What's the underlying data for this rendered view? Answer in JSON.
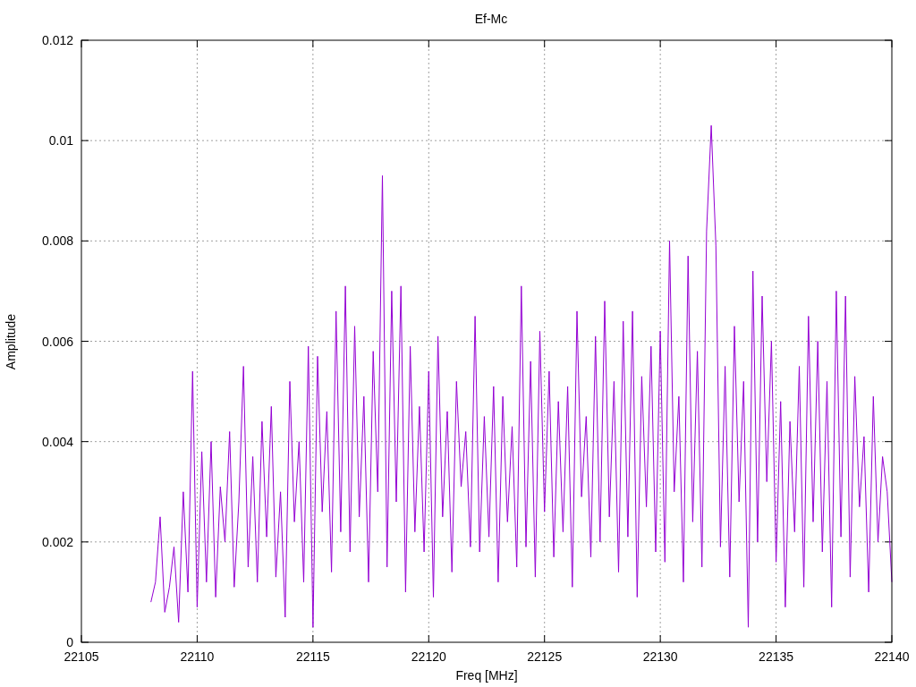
{
  "chart_data": {
    "type": "line",
    "title": "Ef-Mc",
    "xlabel": "Freq [MHz]",
    "ylabel": "Amplitude",
    "xlim": [
      22105,
      22140
    ],
    "ylim": [
      0,
      0.012
    ],
    "grid": true,
    "xticks": [
      {
        "value": 22105,
        "label": "22105"
      },
      {
        "value": 22110,
        "label": "22110"
      },
      {
        "value": 22115,
        "label": "22115"
      },
      {
        "value": 22120,
        "label": "22120"
      },
      {
        "value": 22125,
        "label": "22125"
      },
      {
        "value": 22130,
        "label": "22130"
      },
      {
        "value": 22135,
        "label": "22135"
      },
      {
        "value": 22140,
        "label": "22140"
      }
    ],
    "yticks": [
      {
        "value": 0,
        "label": "0"
      },
      {
        "value": 0.002,
        "label": "0.002"
      },
      {
        "value": 0.004,
        "label": "0.004"
      },
      {
        "value": 0.006,
        "label": "0.006"
      },
      {
        "value": 0.008,
        "label": "0.008"
      },
      {
        "value": 0.01,
        "label": "0.01"
      },
      {
        "value": 0.012,
        "label": "0.012"
      }
    ],
    "x": [
      22108,
      22108.2,
      22108.4,
      22108.6,
      22108.8,
      22109,
      22109.2,
      22109.4,
      22109.6,
      22109.8,
      22110,
      22110.2,
      22110.4,
      22110.6,
      22110.8,
      22111,
      22111.2,
      22111.4,
      22111.6,
      22111.8,
      22112,
      22112.2,
      22112.4,
      22112.6,
      22112.8,
      22113,
      22113.2,
      22113.4,
      22113.6,
      22113.8,
      22114,
      22114.2,
      22114.4,
      22114.6,
      22114.8,
      22115,
      22115.2,
      22115.4,
      22115.6,
      22115.8,
      22116,
      22116.2,
      22116.4,
      22116.6,
      22116.8,
      22117,
      22117.2,
      22117.4,
      22117.6,
      22117.8,
      22118,
      22118.2,
      22118.4,
      22118.6,
      22118.8,
      22119,
      22119.2,
      22119.4,
      22119.6,
      22119.8,
      22120,
      22120.2,
      22120.4,
      22120.6,
      22120.8,
      22121,
      22121.2,
      22121.4,
      22121.6,
      22121.8,
      22122,
      22122.2,
      22122.4,
      22122.6,
      22122.8,
      22123,
      22123.2,
      22123.4,
      22123.6,
      22123.8,
      22124,
      22124.2,
      22124.4,
      22124.6,
      22124.8,
      22125,
      22125.2,
      22125.4,
      22125.6,
      22125.8,
      22126,
      22126.2,
      22126.4,
      22126.6,
      22126.8,
      22127,
      22127.2,
      22127.4,
      22127.6,
      22127.8,
      22128,
      22128.2,
      22128.4,
      22128.6,
      22128.8,
      22129,
      22129.2,
      22129.4,
      22129.6,
      22129.8,
      22130,
      22130.2,
      22130.4,
      22130.6,
      22130.8,
      22131,
      22131.2,
      22131.4,
      22131.6,
      22131.8,
      22132,
      22132.2,
      22132.4,
      22132.6,
      22132.8,
      22133,
      22133.2,
      22133.4,
      22133.6,
      22133.8,
      22134,
      22134.2,
      22134.4,
      22134.6,
      22134.8,
      22135,
      22135.2,
      22135.4,
      22135.6,
      22135.8,
      22136,
      22136.2,
      22136.4,
      22136.6,
      22136.8,
      22137,
      22137.2,
      22137.4,
      22137.6,
      22137.8,
      22138,
      22138.2,
      22138.4,
      22138.6,
      22138.8,
      22139,
      22139.2,
      22139.4,
      22139.6,
      22139.8,
      22140
    ],
    "series": [
      {
        "color": "#9400d3",
        "values": [
          0.0008,
          0.0012,
          0.0025,
          0.0006,
          0.0011,
          0.0019,
          0.0004,
          0.003,
          0.001,
          0.0054,
          0.0007,
          0.0038,
          0.0012,
          0.004,
          0.0009,
          0.0031,
          0.002,
          0.0042,
          0.0011,
          0.0028,
          0.0055,
          0.0015,
          0.0037,
          0.0012,
          0.0044,
          0.0021,
          0.0047,
          0.0013,
          0.003,
          0.0005,
          0.0052,
          0.0024,
          0.004,
          0.0012,
          0.0059,
          0.0003,
          0.0057,
          0.0026,
          0.0046,
          0.0014,
          0.0066,
          0.0022,
          0.0071,
          0.0018,
          0.0063,
          0.0025,
          0.0049,
          0.0012,
          0.0058,
          0.003,
          0.0093,
          0.0015,
          0.007,
          0.0028,
          0.0071,
          0.001,
          0.0059,
          0.0022,
          0.0047,
          0.0018,
          0.0054,
          0.0009,
          0.0061,
          0.0025,
          0.0046,
          0.0014,
          0.0052,
          0.0031,
          0.0042,
          0.0019,
          0.0065,
          0.0018,
          0.0045,
          0.0021,
          0.0051,
          0.0012,
          0.0049,
          0.0024,
          0.0043,
          0.0015,
          0.0071,
          0.0019,
          0.0056,
          0.0013,
          0.0062,
          0.0026,
          0.0054,
          0.0017,
          0.0048,
          0.0022,
          0.0051,
          0.0011,
          0.0066,
          0.0029,
          0.0045,
          0.0017,
          0.0061,
          0.002,
          0.0068,
          0.0025,
          0.0052,
          0.0014,
          0.0064,
          0.0021,
          0.0066,
          0.0009,
          0.0053,
          0.0027,
          0.0059,
          0.0018,
          0.0062,
          0.0016,
          0.008,
          0.003,
          0.0049,
          0.0012,
          0.0077,
          0.0024,
          0.0058,
          0.0015,
          0.0082,
          0.0103,
          0.0079,
          0.0019,
          0.0055,
          0.0013,
          0.0063,
          0.0028,
          0.0052,
          0.0003,
          0.0074,
          0.002,
          0.0069,
          0.0032,
          0.006,
          0.0016,
          0.0048,
          0.0007,
          0.0044,
          0.0022,
          0.0055,
          0.0011,
          0.0065,
          0.0024,
          0.006,
          0.0018,
          0.0052,
          0.0007,
          0.007,
          0.0021,
          0.0069,
          0.0013,
          0.0053,
          0.0027,
          0.0041,
          0.001,
          0.0049,
          0.002,
          0.0037,
          0.003,
          0.0012
        ]
      }
    ]
  }
}
